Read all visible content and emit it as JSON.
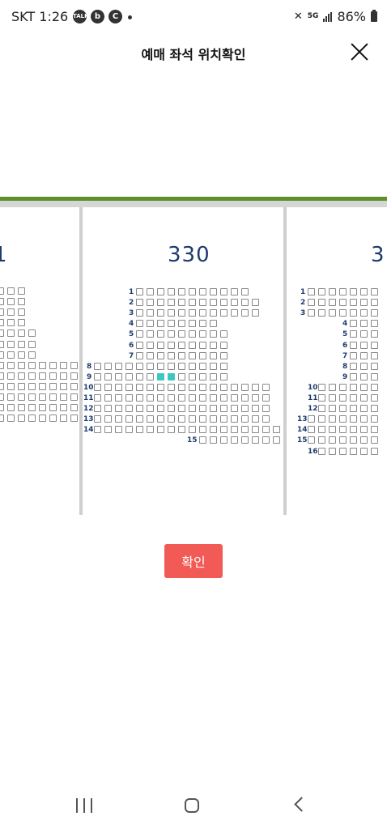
{
  "status_bar": {
    "carrier_time": "SKT 1:26",
    "icons": [
      "talk-icon",
      "b-app-icon",
      "c-app-icon"
    ],
    "talk_label": "TALK",
    "b_label": "b",
    "c_label": "C",
    "net": "5G",
    "battery": "86%"
  },
  "header": {
    "title": "예매 좌석 위치확인"
  },
  "seat_map": {
    "accent_green": "#5f8f2a",
    "selected_color": "#3cc8c0",
    "sections": [
      {
        "label": "1",
        "visible": "partial-left"
      },
      {
        "label": "330",
        "visible": "full"
      },
      {
        "label": "3",
        "visible": "partial-right"
      }
    ],
    "left_rows": [
      {
        "seats": 3
      },
      {
        "seats": 3
      },
      {
        "seats": 3
      },
      {
        "seats": 3
      },
      {
        "seats": 4
      },
      {
        "seats": 4
      },
      {
        "seats": 4
      },
      {
        "seats": 8
      },
      {
        "seats": 8
      },
      {
        "seats": 8
      },
      {
        "seats": 8
      },
      {
        "seats": 8
      },
      {
        "seats": 8
      }
    ],
    "center_rows": [
      {
        "row": "1",
        "seats": 11
      },
      {
        "row": "2",
        "seats": 12
      },
      {
        "row": "3",
        "seats": 12
      },
      {
        "row": "4",
        "seats": 8
      },
      {
        "row": "5",
        "seats": 9
      },
      {
        "row": "6",
        "seats": 9
      },
      {
        "row": "7",
        "seats": 9
      },
      {
        "row": "8",
        "seats": 13
      },
      {
        "row": "9",
        "seats": 13,
        "selected": [
          6,
          7
        ]
      },
      {
        "row": "10",
        "seats": 17
      },
      {
        "row": "11",
        "seats": 17
      },
      {
        "row": "12",
        "seats": 17
      },
      {
        "row": "13",
        "seats": 17
      },
      {
        "row": "14",
        "seats": 18
      },
      {
        "row": "15",
        "seats": 8
      }
    ],
    "right_rows": [
      {
        "row": "1",
        "seats": 7
      },
      {
        "row": "2",
        "seats": 7
      },
      {
        "row": "3",
        "seats": 7
      },
      {
        "row": "4",
        "seats": 4
      },
      {
        "row": "5",
        "seats": 4
      },
      {
        "row": "6",
        "seats": 4
      },
      {
        "row": "7",
        "seats": 4
      },
      {
        "row": "8",
        "seats": 4
      },
      {
        "row": "9",
        "seats": 4
      },
      {
        "row": "10",
        "seats": 7
      },
      {
        "row": "11",
        "seats": 7
      },
      {
        "row": "12",
        "seats": 7
      },
      {
        "row": "13",
        "seats": 9
      },
      {
        "row": "14",
        "seats": 9
      },
      {
        "row": "15",
        "seats": 9
      },
      {
        "row": "16",
        "seats": 8
      }
    ]
  },
  "confirm_button": {
    "label": "확인",
    "color": "#f25a55"
  },
  "nav_bar": {
    "icons": [
      "recent-apps-icon",
      "home-icon",
      "back-icon"
    ]
  }
}
